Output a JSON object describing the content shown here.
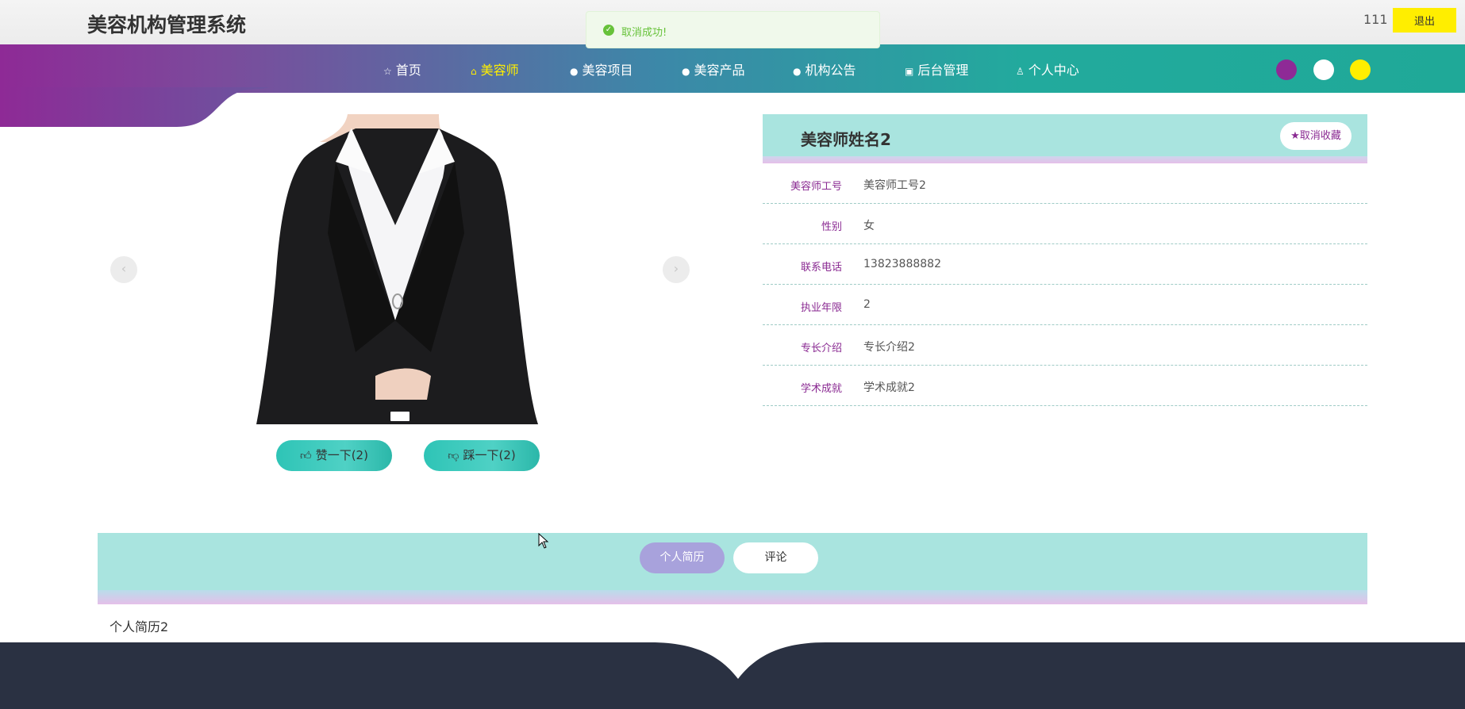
{
  "header": {
    "site_title": "美容机构管理系统",
    "username": "111",
    "logout_label": "退出"
  },
  "toast": {
    "message": "取消成功!",
    "icon": "check-circle-icon",
    "color": "#67c23a"
  },
  "nav": {
    "items": [
      {
        "label": "首页",
        "icon": "star-outline-icon",
        "active": false
      },
      {
        "label": "美容师",
        "icon": "bag-icon",
        "active": true
      },
      {
        "label": "美容项目",
        "icon": "info-circle-icon",
        "active": false
      },
      {
        "label": "美容产品",
        "icon": "question-circle-icon",
        "active": false
      },
      {
        "label": "机构公告",
        "icon": "info-circle-icon",
        "active": false
      },
      {
        "label": "后台管理",
        "icon": "shop-icon",
        "active": false
      },
      {
        "label": "个人中心",
        "icon": "user-icon",
        "active": false
      }
    ],
    "active_color": "#ffee00",
    "theme_colors": [
      "#8e2a96",
      "#ffffff",
      "#ffee00"
    ]
  },
  "gallery": {
    "prev_icon": "chevron-left-icon",
    "next_icon": "chevron-right-icon"
  },
  "votes": {
    "like_label": "赞一下(2)",
    "dislike_label": "踩一下(2)"
  },
  "detail": {
    "name": "美容师姓名2",
    "favorite_label": "取消收藏",
    "fields": [
      {
        "label": "美容师工号",
        "value": "美容师工号2"
      },
      {
        "label": "性别",
        "value": "女"
      },
      {
        "label": "联系电话",
        "value": "13823888882"
      },
      {
        "label": "执业年限",
        "value": "2"
      },
      {
        "label": "专长介绍",
        "value": "专长介绍2"
      },
      {
        "label": "学术成就",
        "value": "学术成就2"
      }
    ]
  },
  "tabs": {
    "items": [
      {
        "label": "个人简历",
        "active": true
      },
      {
        "label": "评论",
        "active": false
      }
    ],
    "content": "个人简历2"
  },
  "colors": {
    "accent_purple": "#8a2a92",
    "accent_teal": "#1fa998",
    "panel_teal": "#a9e4df",
    "footer": "#2a3142"
  }
}
